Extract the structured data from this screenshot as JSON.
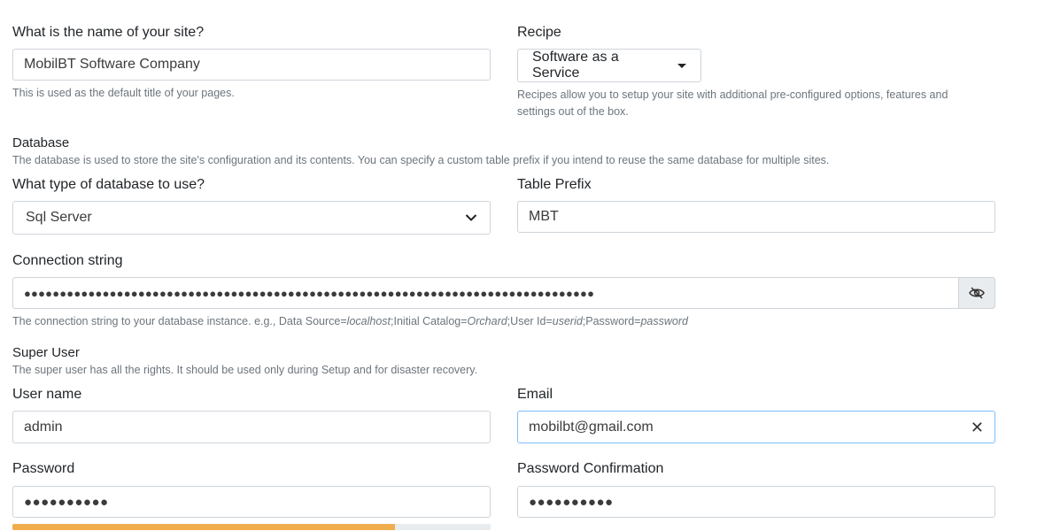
{
  "site": {
    "name_label": "What is the name of your site?",
    "name_value": "MobilBT Software Company",
    "name_help": "This is used as the default title of your pages."
  },
  "recipe": {
    "label": "Recipe",
    "selected": "Software as a Service",
    "help": "Recipes allow you to setup your site with additional pre-configured options, features and settings out of the box."
  },
  "database": {
    "title": "Database",
    "description": "The database is used to store the site's configuration and its contents. You can specify a custom table prefix if you intend to reuse the same database for multiple sites.",
    "type_label": "What type of database to use?",
    "type_selected": "Sql Server",
    "prefix_label": "Table Prefix",
    "prefix_value": "MBT",
    "connection_label": "Connection string",
    "connection_masked": "●●●●●●●●●●●●●●●●●●●●●●●●●●●●●●●●●●●●●●●●●●●●●●●●●●●●●●●●●●●●●●●●●●●●●●●●●●●●●●●●",
    "connection_help": {
      "prefix": "The connection string to your database instance. e.g., Data Source=",
      "localhost": "localhost",
      "mid1": ";Initial Catalog=",
      "orchard": "Orchard",
      "mid2": ";User Id=",
      "userid": "userid",
      "mid3": ";Password=",
      "password": "password"
    }
  },
  "super_user": {
    "title": "Super User",
    "description": "The super user has all the rights. It should be used only during Setup and for disaster recovery.",
    "username_label": "User name",
    "username_value": "admin",
    "email_label": "Email",
    "email_value": "mobilbt@gmail.com",
    "password_label": "Password",
    "password_masked": "●●●●●●●●●●",
    "password_strength": 0.8,
    "confirm_label": "Password Confirmation",
    "confirm_masked": "●●●●●●●●●●"
  },
  "icons": {
    "dropdown": "chevron-down-icon",
    "toggle_visibility": "eye-slash-icon",
    "clear": "close-icon",
    "recipe_caret": "caret-down-icon"
  },
  "colors": {
    "strength_bar": "#f0ad4e",
    "focus_border": "#80bdff"
  }
}
